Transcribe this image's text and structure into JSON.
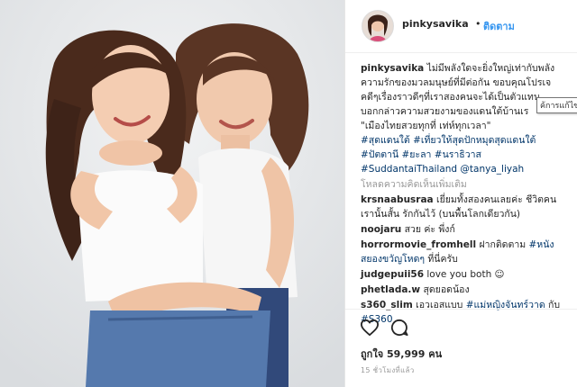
{
  "post": {
    "username": "pinkysavika",
    "separator": "•",
    "follow_label": "ติดตาม"
  },
  "caption": {
    "username": "pinkysavika",
    "lines": [
      "ไม่มีพลังใดจะยิ่งใหญ่เท่ากับพลัง",
      "ความรักของมวลมนุษย์ที่มีต่อกัน ขอบคุณโปรเจ",
      "คดีๆเรื่องราวดีๆที่เราสองคนจะได้เป็นตัวแทน",
      "บอกกล่าวความสวยงามของแดนใต้บ้านเร",
      "\"เมืองไทยสวยทุกที่ เท่ห์ทุกเวลา\""
    ],
    "hashtags_1": "#สุดแดนใต้ #เที่ยวให้สุดปักหมุดสุดแดนใต้",
    "hashtags_2": "#ปัตตานี #ยะลา #นราธิวาส",
    "hashtags_3": "#SuddantaiThailand @tanya_liyah"
  },
  "tooltip": "ค้การแก้ไข",
  "load_more": "โหลดความคิดเห็นเพิ่มเติม",
  "comments": [
    {
      "user": "krsnaabusraa",
      "text": "เยี่ยมทั้งสองคนเลยค่ะ ชีวิตคน",
      "text2": "เรานั้นสั้น รักกันไว้ (บนพื้นโลกเดียวกัน)"
    },
    {
      "user": "noojaru",
      "text": "สวย ค่ะ พี่งก์"
    },
    {
      "user": "horrormovie_fromhell",
      "text": "ฝากติดตาม",
      "tag": "#หนัง",
      "text2_tag": "สยองขวัญโหดๆ",
      "text2": " ที่นี่ครับ"
    },
    {
      "user": "judgepuii56",
      "text": "love you both ☺"
    },
    {
      "user": "phetlada.w",
      "text": "สุดยอดน้อง"
    },
    {
      "user": "s360_slim",
      "text": "เอวเอสแบบ",
      "tag": "#แม่หญิงจันทร์วาด",
      "text_after": " กับ",
      "tag2": "#S360"
    }
  ],
  "actions": {
    "like_icon": "heart-icon",
    "comment_icon": "comment-icon"
  },
  "likes_text": "ถูกใจ 59,999 คน",
  "timestamp": "15 ชั่วโมงที่แล้ว"
}
